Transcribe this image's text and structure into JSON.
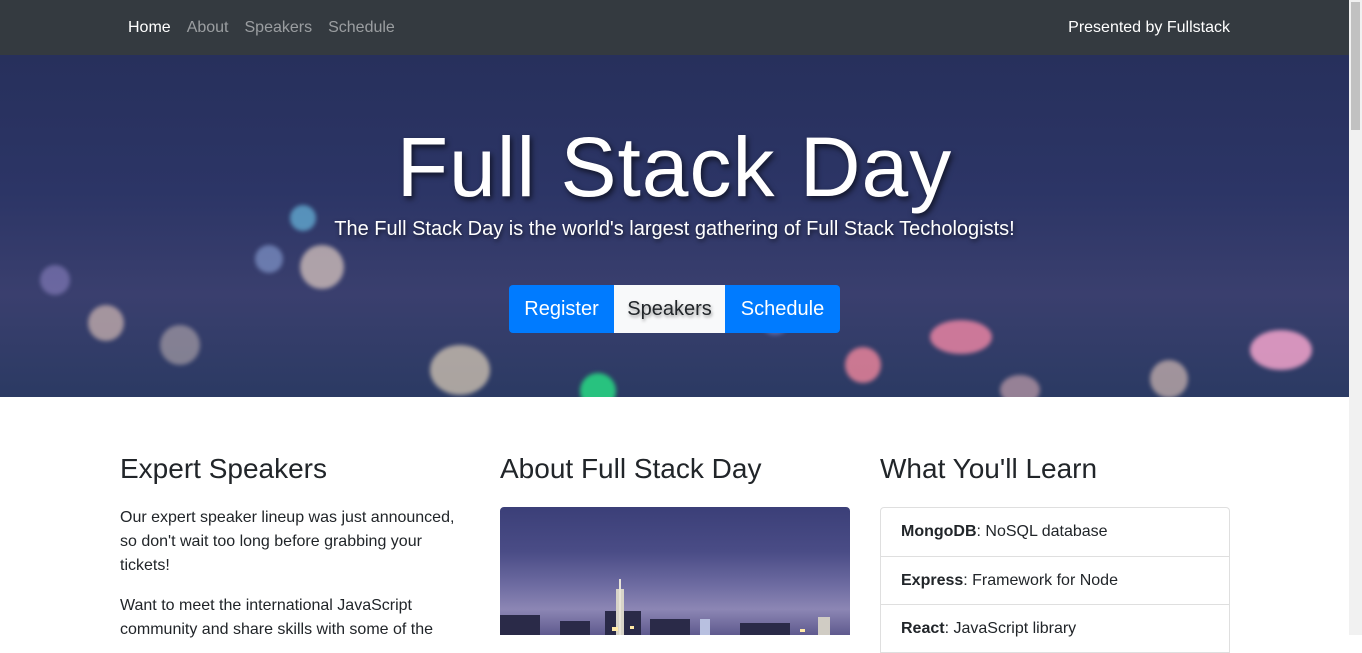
{
  "nav": {
    "links": [
      "Home",
      "About",
      "Speakers",
      "Schedule"
    ],
    "right_text": "Presented by Fullstack"
  },
  "hero": {
    "title": "Full Stack Day",
    "subtitle": "The Full Stack Day is the world's largest gathering of Full Stack Techologists!",
    "buttons": [
      "Register",
      "Speakers",
      "Schedule"
    ]
  },
  "speakers": {
    "heading": "Expert Speakers",
    "paragraphs": [
      "Our expert speaker lineup was just announced, so don't wait too long before grabbing your tickets!",
      "Want to meet the international JavaScript community and share skills with some of the"
    ]
  },
  "about": {
    "heading": "About Full Stack Day"
  },
  "learn": {
    "heading": "What You'll Learn",
    "items": [
      {
        "name": "MongoDB",
        "desc": ": NoSQL database"
      },
      {
        "name": "Express",
        "desc": ": Framework for Node"
      },
      {
        "name": "React",
        "desc": ": JavaScript library"
      }
    ]
  },
  "colors": {
    "navbar": "#343a40",
    "primary": "#007bff",
    "light": "#f8f9fa"
  }
}
